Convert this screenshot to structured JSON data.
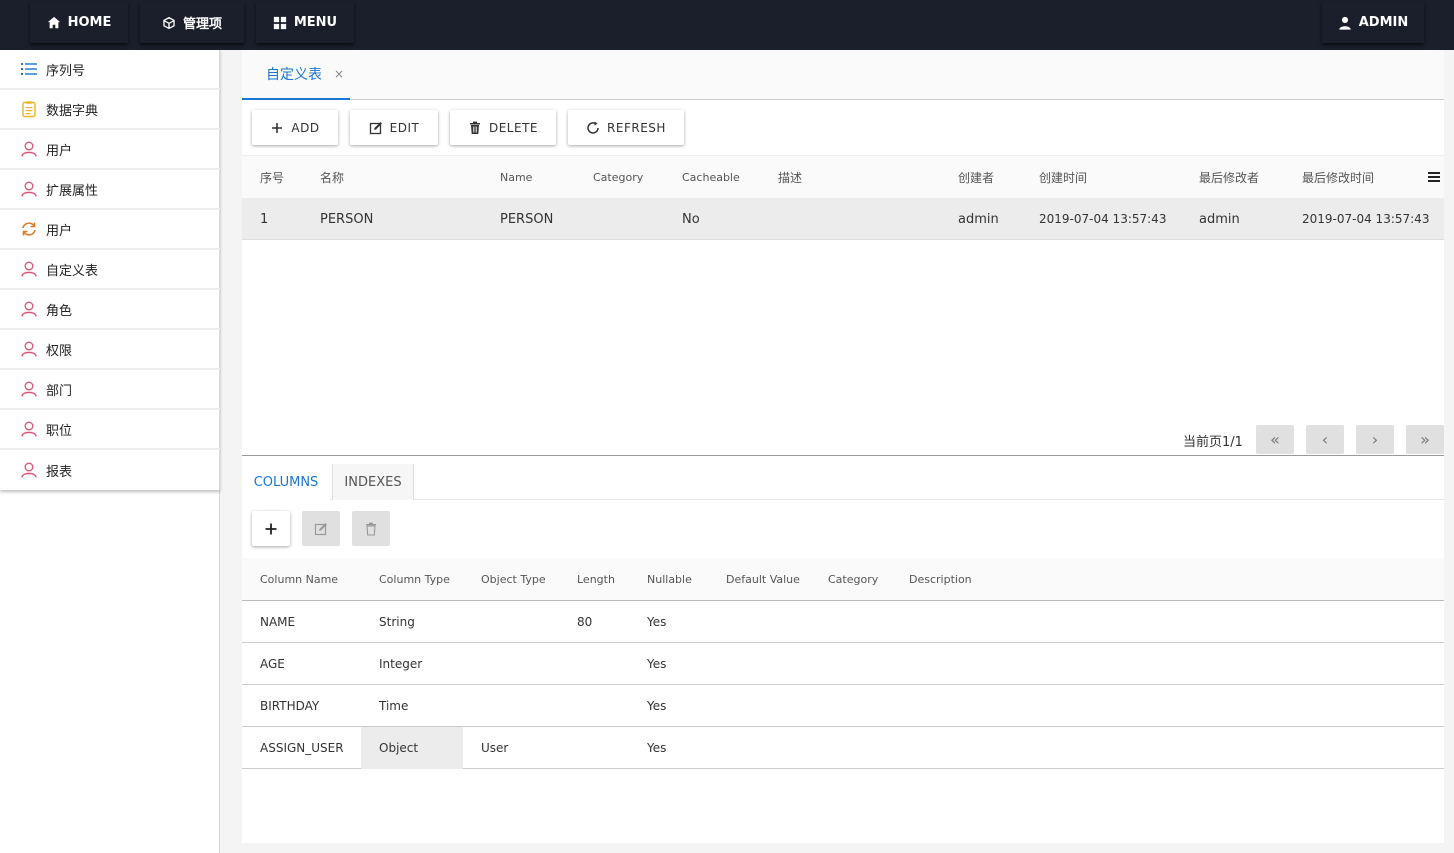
{
  "topbar": {
    "home_label": "HOME",
    "manage_label": "管理项",
    "menu_label": "MENU",
    "admin_label": "ADMIN"
  },
  "sidebar": {
    "items": [
      {
        "label": "序列号",
        "icon": "list-icon"
      },
      {
        "label": "数据字典",
        "icon": "clipboard-icon"
      },
      {
        "label": "用户",
        "icon": "user-icon"
      },
      {
        "label": "扩展属性",
        "icon": "user-icon"
      },
      {
        "label": "用户",
        "icon": "sync-icon"
      },
      {
        "label": "自定义表",
        "icon": "user-icon"
      },
      {
        "label": "角色",
        "icon": "user-icon"
      },
      {
        "label": "权限",
        "icon": "user-icon"
      },
      {
        "label": "部门",
        "icon": "user-icon"
      },
      {
        "label": "职位",
        "icon": "user-icon"
      },
      {
        "label": "报表",
        "icon": "user-icon"
      }
    ]
  },
  "tabs": {
    "active_label": "自定义表",
    "close": "×"
  },
  "toolbar": {
    "add_label": "ADD",
    "edit_label": "EDIT",
    "delete_label": "DELETE",
    "refresh_label": "REFRESH"
  },
  "grid": {
    "headers": [
      "序号",
      "名称",
      "Name",
      "Category",
      "Cacheable",
      "描述",
      "创建者",
      "创建时间",
      "最后修改者",
      "最后修改时间"
    ],
    "rows": [
      [
        "1",
        "PERSON",
        "PERSON",
        "",
        "No",
        "",
        "admin",
        "2019-07-04 13:57:43",
        "admin",
        "2019-07-04 13:57:43"
      ]
    ]
  },
  "pager": {
    "text": "当前页1/1",
    "first": "«",
    "prev": "‹",
    "next": "›",
    "last": "»"
  },
  "subtabs": {
    "columns_label": "COLUMNS",
    "indexes_label": "INDEXES"
  },
  "columns_table": {
    "headers": [
      "Column Name",
      "Column Type",
      "Object Type",
      "Length",
      "Nullable",
      "Default Value",
      "Category",
      "Description"
    ],
    "rows": [
      [
        "NAME",
        "String",
        "",
        "80",
        "Yes",
        "",
        "",
        ""
      ],
      [
        "AGE",
        "Integer",
        "",
        "",
        "Yes",
        "",
        "",
        ""
      ],
      [
        "BIRTHDAY",
        "Time",
        "",
        "",
        "Yes",
        "",
        "",
        ""
      ],
      [
        "ASSIGN_USER",
        "Object",
        "User",
        "",
        "Yes",
        "",
        "",
        ""
      ]
    ]
  },
  "colors": {
    "topbar_bg": "#1b1e2b",
    "accent": "#1976d2",
    "user_icon": "#e0567a",
    "list_icon": "#1976d2",
    "clipboard_icon": "#f0b429",
    "sync_icon": "#e07b2a"
  }
}
